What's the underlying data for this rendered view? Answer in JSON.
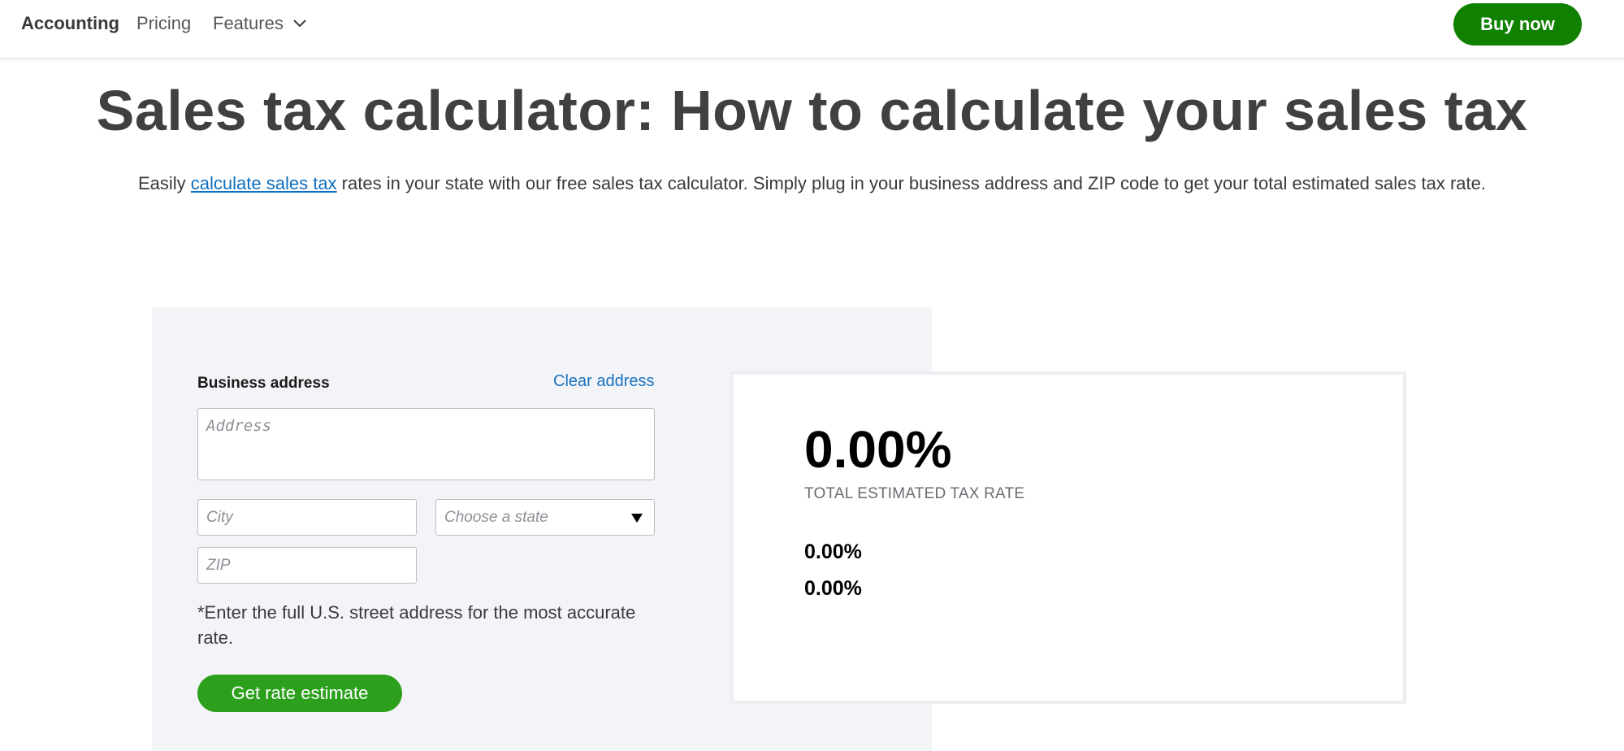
{
  "nav": {
    "links": [
      {
        "label": "Accounting"
      },
      {
        "label": "Pricing"
      },
      {
        "label": "Features"
      }
    ],
    "buy_now": "Buy now"
  },
  "hero": {
    "title": "Sales tax calculator: How to calculate your sales tax",
    "desc_prefix": "Easily ",
    "desc_link": "calculate sales tax",
    "desc_suffix": " rates in your state with our free sales tax calculator. Simply plug in your business address and ZIP code to get your total estimated sales tax rate."
  },
  "form": {
    "business_address_label": "Business address",
    "clear_address": "Clear address",
    "address_placeholder": "Address",
    "city_placeholder": "City",
    "state_placeholder": "Choose a state",
    "zip_placeholder": "ZIP",
    "note": "*Enter the full U.S. street address for the most accurate rate.",
    "submit_label": "Get rate estimate"
  },
  "result": {
    "total_rate": "0.00%",
    "total_caption": "TOTAL ESTIMATED TAX RATE",
    "rate_line_1": "0.00%",
    "rate_line_2": "0.00%"
  },
  "colors": {
    "buy_now_bg": "#108000",
    "estimate_btn_bg": "#2ca01c",
    "link": "#0d6fbf",
    "panel_bg": "#f3f4f7"
  },
  "icons": {
    "features_dropdown": "chevron-down-icon",
    "state_dropdown": "caret-down-icon"
  }
}
